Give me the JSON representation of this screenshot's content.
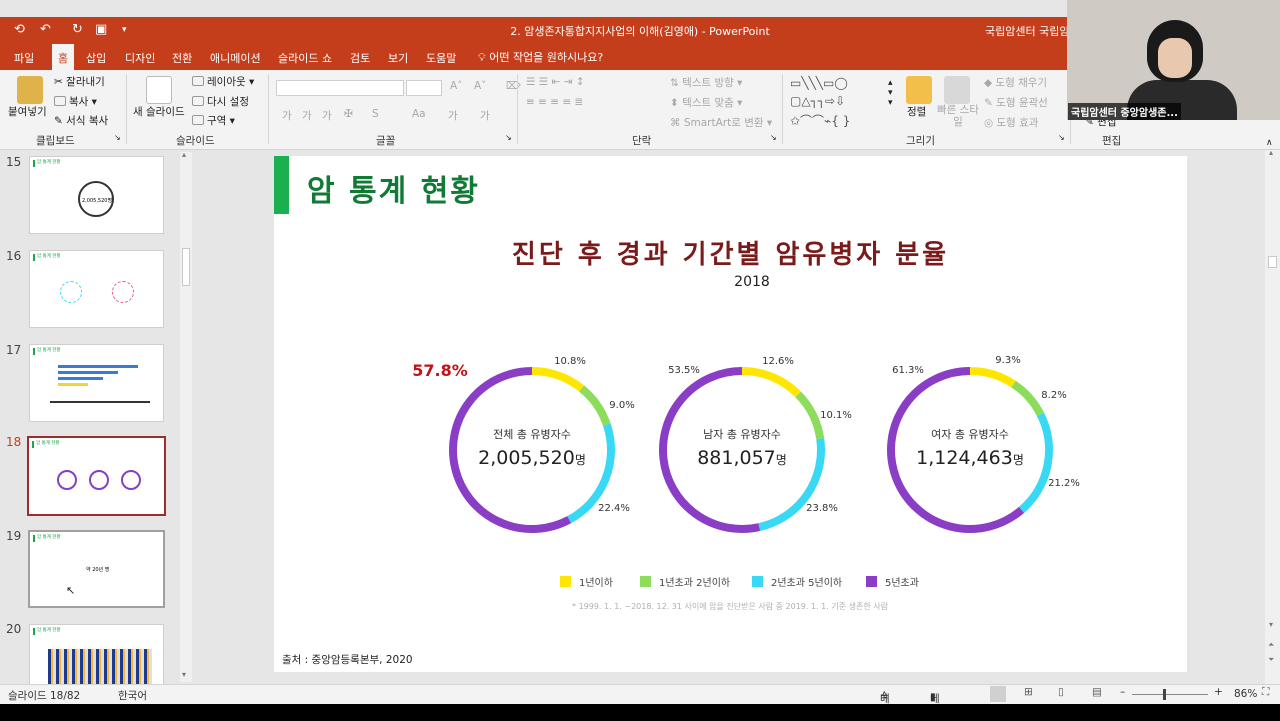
{
  "titlebar": {
    "doc_title": "2. 암생존자통합지지사업의 이해(김영애)  -  PowerPoint",
    "user": "국립암센터 국립암"
  },
  "tabs": [
    "파일",
    "홈",
    "삽입",
    "디자인",
    "전환",
    "애니메이션",
    "슬라이드 쇼",
    "검토",
    "보기",
    "도움말"
  ],
  "tell_me": "어떤 작업을 원하시나요?",
  "ribbon": {
    "paste": "붙여넣기",
    "cut": "잘라내기",
    "copy": "복사",
    "format_painter": "서식 복사",
    "new_slide": "새 슬라이드",
    "layout": "레이아웃",
    "reset": "다시 설정",
    "section": "구역",
    "text_direction": "텍스트 방향",
    "align_text": "텍스트 맞춤",
    "smartart": "SmartArt로 변환",
    "arrange": "정렬",
    "quick_styles": "빠른 스타일",
    "shape_fill": "도형 채우기",
    "shape_outline": "도형 윤곽선",
    "shape_effects": "도형 효과",
    "edit_label": "편집",
    "groups": [
      "클립보드",
      "슬라이드",
      "글꼴",
      "단락",
      "그리기",
      "편집"
    ]
  },
  "webcam": {
    "name": "국립암센터 중앙암생존..."
  },
  "thumbnails": [
    {
      "num": "15",
      "title": "암 통계 현황",
      "note": "2,005,520명"
    },
    {
      "num": "16",
      "title": "암 통계 현황",
      "note": ""
    },
    {
      "num": "17",
      "title": "암 통계 현황",
      "note": ""
    },
    {
      "num": "18",
      "title": "암 통계 현황",
      "note": ""
    },
    {
      "num": "19",
      "title": "암 통계 현황",
      "note": "약 20년 명"
    },
    {
      "num": "20",
      "title": "암 통계 현황",
      "note": ""
    }
  ],
  "slide": {
    "header": "암 통계 현황",
    "chart_title": "진단 후 경과 기간별 암유병자 분율",
    "year": "2018",
    "source": "출처 : 중앙암등록본부, 2020",
    "footnote": "* 1999. 1. 1. ~2018. 12. 31 사이에 암을 진단받은 사람 중 2019. 1. 1. 기준 생존한 사람"
  },
  "chart_data": {
    "type": "pie",
    "title": "진단 후 경과 기간별 암유병자 분율",
    "subtitle": "2018",
    "legend": [
      "1년이하",
      "1년초과 2년이하",
      "2년초과 5년이하",
      "5년초과"
    ],
    "legend_placement": "bottom",
    "colors": [
      "#ffe600",
      "#8cdd5c",
      "#39d8f5",
      "#8a3ec6"
    ],
    "charts": [
      {
        "name": "전체 총 유병자수",
        "total": "2,005,520",
        "unit": "명",
        "values": [
          10.8,
          9.0,
          22.4,
          57.8
        ],
        "labels": [
          "10.8%",
          "9.0%",
          "22.4%",
          "57.8%"
        ]
      },
      {
        "name": "남자 총 유병자수",
        "total": "881,057",
        "unit": "명",
        "values": [
          12.6,
          10.1,
          23.8,
          53.5
        ],
        "labels": [
          "12.6%",
          "10.1%",
          "23.8%",
          "53.5%"
        ]
      },
      {
        "name": "여자 총 유병자수",
        "total": "1,124,463",
        "unit": "명",
        "values": [
          9.3,
          8.2,
          21.2,
          61.3
        ],
        "labels": [
          "9.3%",
          "8.2%",
          "21.2%",
          "61.3%"
        ]
      }
    ],
    "highlight_color": "#c0141b"
  },
  "status": {
    "slide_count": "슬라이드 18/82",
    "language": "한국어",
    "notes": "메모",
    "comments": "메모",
    "zoom": "86%"
  }
}
